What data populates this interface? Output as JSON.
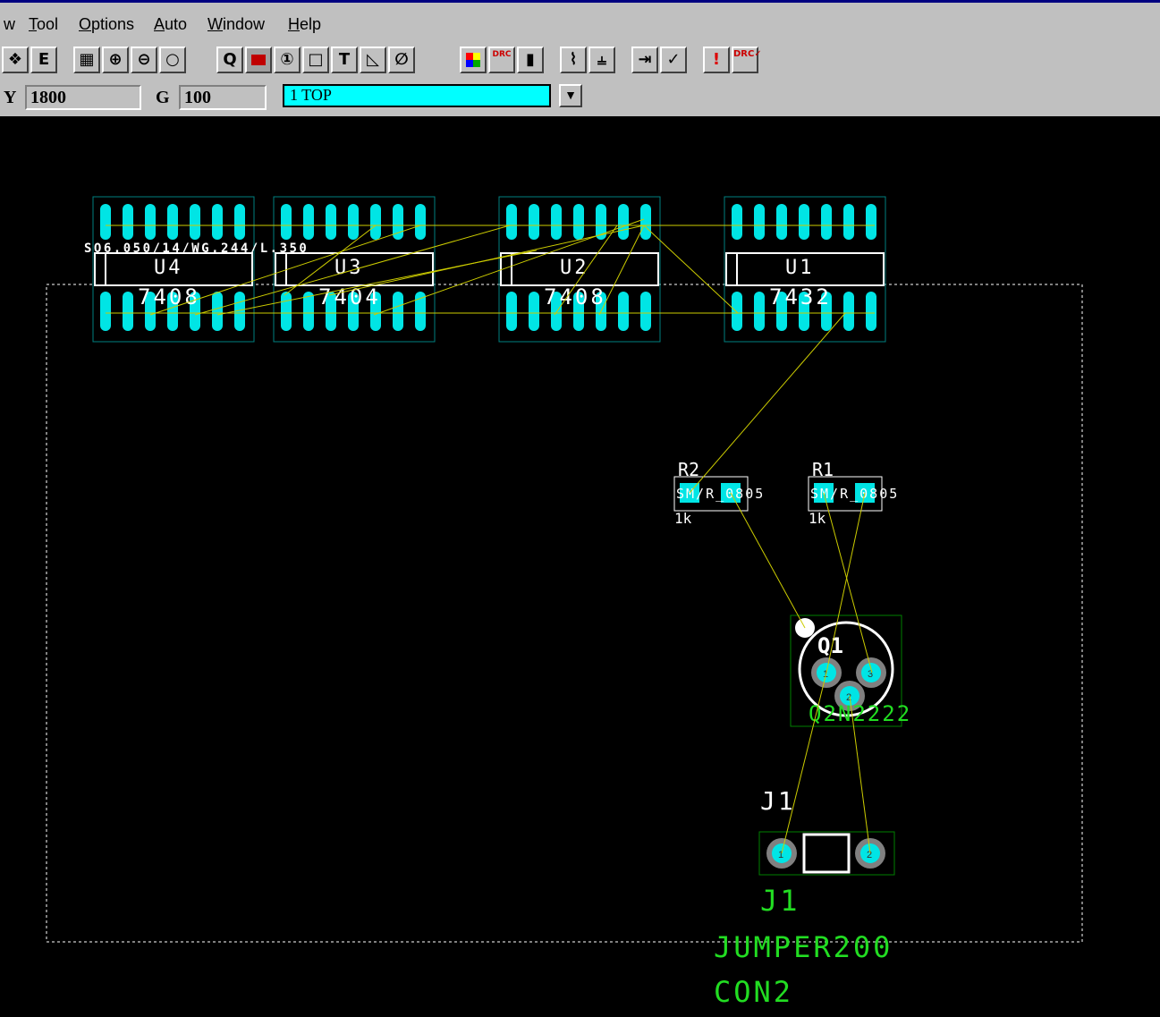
{
  "menu": [
    {
      "label": "w"
    },
    {
      "label": "Tool"
    },
    {
      "label": "Options"
    },
    {
      "label": "Auto"
    },
    {
      "label": "Window"
    },
    {
      "label": "Help"
    }
  ],
  "coords": {
    "y_label": "Y",
    "y_value": "1800",
    "g_label": "G",
    "g_value": "100"
  },
  "layer": {
    "selected": "1 TOP"
  },
  "toolbar": {
    "buttons": [
      "find-icon",
      "eco-icon",
      "grid-icon",
      "zoom-in-icon",
      "zoom-out-icon",
      "zoom-fit-icon",
      "query-icon",
      "component-icon",
      "pin-number-icon",
      "note-icon",
      "text-icon",
      "route-icon",
      "no-connect-icon",
      "layer-colors-icon",
      "drc-colors-icon",
      "connection-icon",
      "autoroute-icon",
      "split-icon",
      "import-icon",
      "export-icon",
      "error-icon",
      "drc-check-icon"
    ]
  },
  "components": {
    "u4": {
      "ref": "U4",
      "value": "7408"
    },
    "u3": {
      "ref": "U3",
      "value": "7404"
    },
    "u2": {
      "ref": "U2",
      "value": "7408"
    },
    "u1": {
      "ref": "U1",
      "value": "7432"
    },
    "footprint_text": "SO6.050/14/WG.244/L.350",
    "r2": {
      "ref": "R2",
      "value": "1k",
      "footprint": "SM/R_0805"
    },
    "r1": {
      "ref": "R1",
      "value": "1k",
      "footprint": "SM/R_0805"
    },
    "q1": {
      "ref": "Q1",
      "value": "Q2N2222",
      "pins": [
        "1",
        "3",
        "2"
      ]
    },
    "j1": {
      "ref": "J1",
      "name": "J1",
      "value": "JUMPER200",
      "type": "CON2",
      "pins": [
        "1",
        "2"
      ]
    }
  },
  "colors": {
    "background": "#000000",
    "pad": "#00e5e5",
    "ratsnest": "#cccc00",
    "silkscreen": "#ffffff",
    "value_text": "#22dd22",
    "outline": "#ffffff",
    "footprint_box": "#008000"
  }
}
